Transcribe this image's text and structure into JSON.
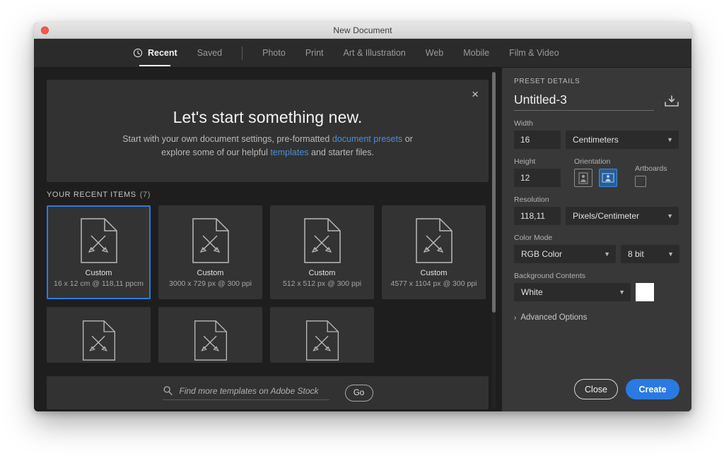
{
  "window": {
    "title": "New Document",
    "close_dot": "close-window-dot"
  },
  "tabs": [
    {
      "label": "Recent",
      "icon": "clock-icon",
      "active": true
    },
    {
      "label": "Saved",
      "active": false
    },
    {
      "label": "Photo",
      "active": false
    },
    {
      "label": "Print",
      "active": false
    },
    {
      "label": "Art & Illustration",
      "active": false
    },
    {
      "label": "Web",
      "active": false
    },
    {
      "label": "Mobile",
      "active": false
    },
    {
      "label": "Film & Video",
      "active": false
    }
  ],
  "banner": {
    "title": "Let's start something new.",
    "line1_pre": "Start with your own document settings, pre-formatted ",
    "line1_link": "document presets",
    "line1_post": " or",
    "line2_pre": "explore some of our helpful ",
    "line2_link": "templates",
    "line2_post": " and starter files.",
    "close_icon": "×"
  },
  "recent": {
    "header": "YOUR RECENT ITEMS",
    "count": "(7)",
    "items": [
      {
        "name": "Custom",
        "meta": "16 x 12 cm @ 118,11 ppcm",
        "selected": true
      },
      {
        "name": "Custom",
        "meta": "3000 x 729 px @ 300 ppi",
        "selected": false
      },
      {
        "name": "Custom",
        "meta": "512 x 512 px @ 300 ppi",
        "selected": false
      },
      {
        "name": "Custom",
        "meta": "4577 x 1104 px @ 300 ppi",
        "selected": false
      }
    ],
    "items_row2": [
      {
        "name": "",
        "meta": ""
      },
      {
        "name": "",
        "meta": ""
      },
      {
        "name": "",
        "meta": ""
      }
    ]
  },
  "search": {
    "placeholder": "Find more templates on Adobe Stock",
    "value": "",
    "go_label": "Go",
    "icon": "search-icon"
  },
  "preset": {
    "section_label": "PRESET DETAILS",
    "name_value": "Untitled-3",
    "save_icon": "save-preset-icon",
    "width_label": "Width",
    "width_value": "16",
    "width_unit": "Centimeters",
    "height_label": "Height",
    "height_value": "12",
    "orientation_label": "Orientation",
    "orientation_portrait": "portrait-icon",
    "orientation_landscape": "landscape-icon",
    "artboards_label": "Artboards",
    "artboards_checked": false,
    "resolution_label": "Resolution",
    "resolution_value": "118,11",
    "resolution_unit": "Pixels/Centimeter",
    "color_mode_label": "Color Mode",
    "color_mode_value": "RGB Color",
    "color_depth_value": "8 bit",
    "background_label": "Background Contents",
    "background_value": "White",
    "background_swatch": "#ffffff",
    "advanced_label": "Advanced Options",
    "advanced_chevron": "›"
  },
  "footer": {
    "close_label": "Close",
    "create_label": "Create"
  },
  "colors": {
    "accent_blue": "#2a7ae2",
    "link_blue": "#4a8fd4",
    "panel_bg": "#383838",
    "main_bg": "#1e1e1e",
    "card_bg": "#333333"
  }
}
